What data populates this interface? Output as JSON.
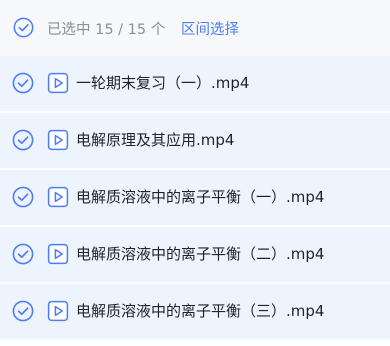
{
  "header": {
    "selected_prefix": "已选中 ",
    "selected_count": "15",
    "separator": " / ",
    "total_count": "15",
    "unit": " 个",
    "range_select_label": "区间选择"
  },
  "files": [
    {
      "name": "一轮期末复习（一）.mp4",
      "selected": true,
      "icon": "video-file-icon"
    },
    {
      "name": "电解原理及其应用.mp4",
      "selected": true,
      "icon": "video-file-icon"
    },
    {
      "name": "电解质溶液中的离子平衡（一）.mp4",
      "selected": true,
      "icon": "video-file-icon"
    },
    {
      "name": "电解质溶液中的离子平衡（二）.mp4",
      "selected": true,
      "icon": "video-file-icon"
    },
    {
      "name": "电解质溶液中的离子平衡（三）.mp4",
      "selected": true,
      "icon": "video-file-icon"
    }
  ],
  "colors": {
    "accent": "#4e7cf6",
    "row_background": "#eef4fe",
    "header_background": "#f7f8fa",
    "muted_text": "#8a8f99",
    "text": "#1f2329"
  },
  "icons": {
    "select_all": "check-circle-icon",
    "row_check": "check-circle-icon",
    "file_type": "video-file-icon"
  }
}
